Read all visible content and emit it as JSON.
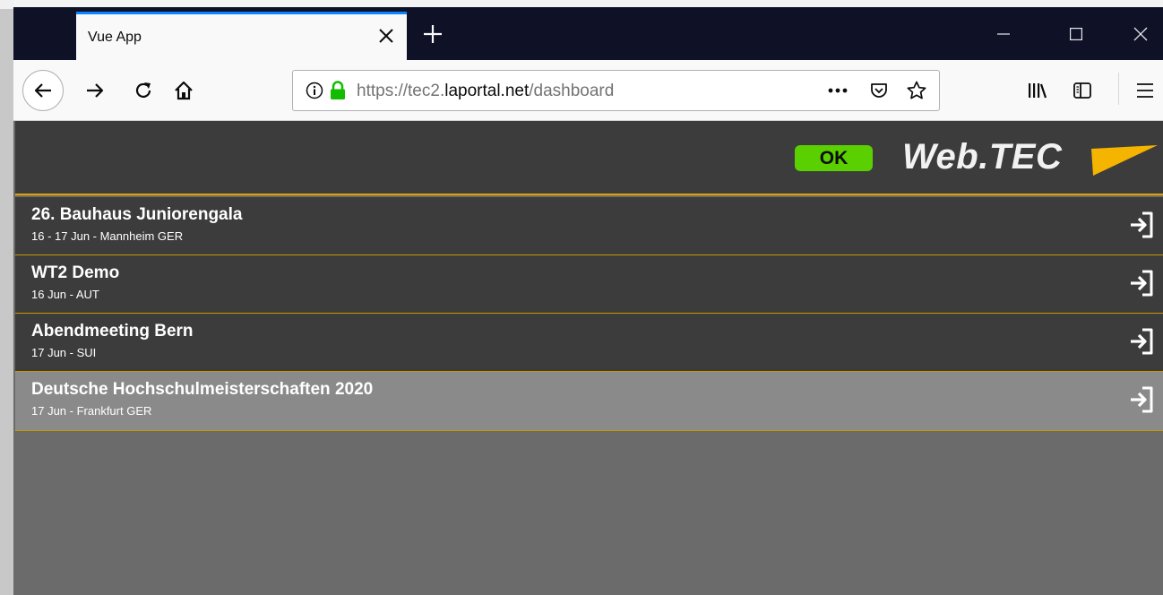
{
  "browser": {
    "tab": {
      "title": "Vue App"
    },
    "url": {
      "prefix": "https://tec2.",
      "domain": "laportal.net",
      "path": "/dashboard"
    }
  },
  "app": {
    "status_badge": "OK",
    "brand": "Web.TEC",
    "colors": {
      "accent": "#e0a400",
      "ok": "#5bd000",
      "row": "#3c3c3c",
      "row_highlight": "#8a8a8a"
    },
    "events": [
      {
        "name": "26. Bauhaus Juniorengala",
        "meta": "16 - 17 Jun - Mannheim GER"
      },
      {
        "name": "WT2 Demo",
        "meta": "16 Jun - AUT"
      },
      {
        "name": "Abendmeeting Bern",
        "meta": "17 Jun - SUI"
      },
      {
        "name": "Deutsche Hochschulmeisterschaften 2020",
        "meta": "17 Jun - Frankfurt GER"
      }
    ]
  },
  "icons": {
    "tab_close": "close-icon",
    "new_tab": "plus-icon",
    "back": "arrow-left-icon",
    "forward": "arrow-right-icon",
    "reload": "reload-icon",
    "home": "home-icon",
    "info": "info-icon",
    "lock": "lock-icon",
    "page_actions": "more-horizontal-icon",
    "pocket": "pocket-icon",
    "bookmark": "star-icon",
    "library": "library-icon",
    "sidebar": "sidebar-icon",
    "menu": "hamburger-menu-icon",
    "enter": "sign-in-icon"
  }
}
